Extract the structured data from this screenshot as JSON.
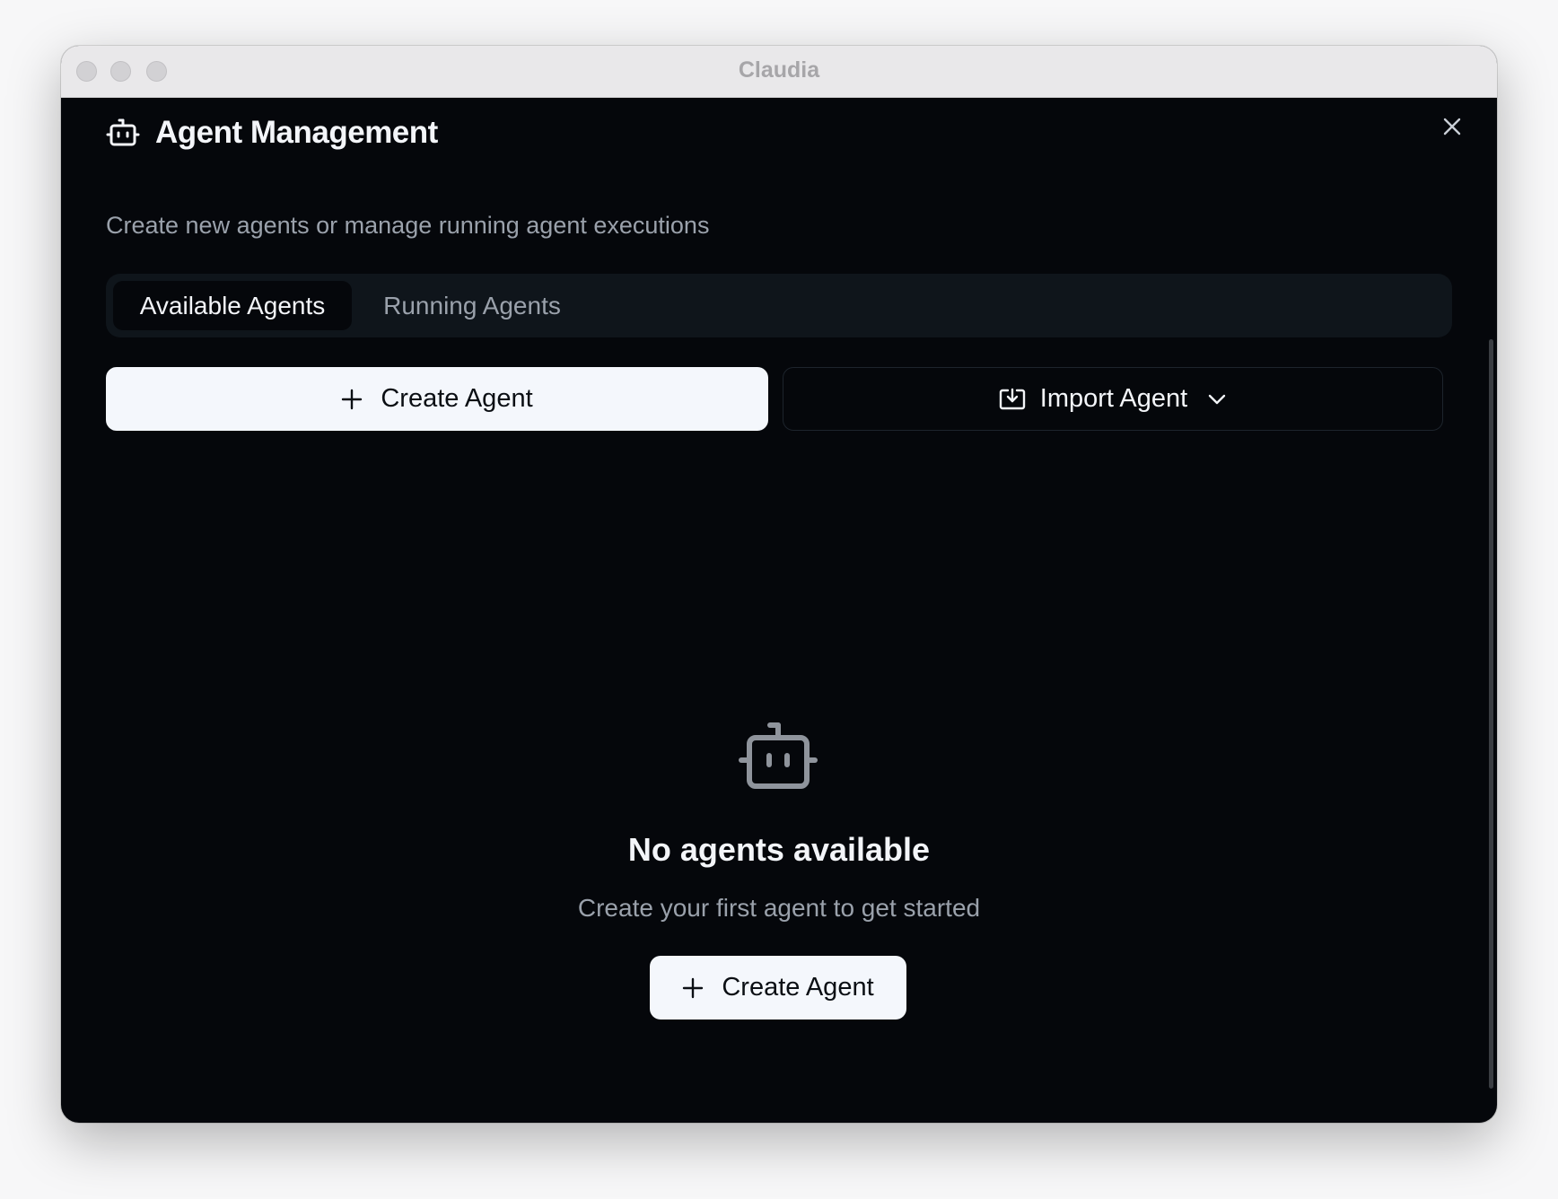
{
  "window": {
    "title": "Claudia"
  },
  "header": {
    "title": "Agent Management",
    "subtitle": "Create new agents or manage running agent executions",
    "icon": "bot-icon"
  },
  "tabs": [
    {
      "label": "Available Agents",
      "active": true
    },
    {
      "label": "Running Agents",
      "active": false
    }
  ],
  "actions": {
    "create_label": "Create Agent",
    "import_label": "Import Agent"
  },
  "empty_state": {
    "icon": "bot-icon",
    "title": "No agents available",
    "subtitle": "Create your first agent to get started",
    "button_label": "Create Agent"
  },
  "colors": {
    "background": "#05070b",
    "primary_button": "#f4f7fc",
    "muted_text": "#9aa1ab",
    "tabs_background": "#0f151b"
  }
}
